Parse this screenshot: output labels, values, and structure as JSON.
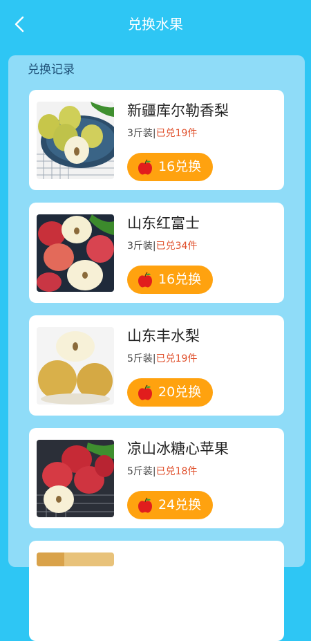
{
  "header": {
    "title": "兑换水果"
  },
  "panel": {
    "section_title": "兑换记录"
  },
  "items": [
    {
      "name": "新疆库尔勒香梨",
      "pack": "3斤装",
      "sold": "已兑19件",
      "button_label": "16兑换",
      "image": "pear-plate"
    },
    {
      "name": "山东红富士",
      "pack": "3斤装",
      "sold": "已兑34件",
      "button_label": "16兑换",
      "image": "red-apples"
    },
    {
      "name": "山东丰水梨",
      "pack": "5斤装",
      "sold": "已兑19件",
      "button_label": "20兑换",
      "image": "asian-pears"
    },
    {
      "name": "凉山冰糖心苹果",
      "pack": "5斤装",
      "sold": "已兑18件",
      "button_label": "24兑换",
      "image": "apples-plate"
    }
  ],
  "colors": {
    "background": "#2ec6f4",
    "panel": "#8fdcf8",
    "button": "#ffa20f",
    "sold_text": "#e0502c"
  }
}
